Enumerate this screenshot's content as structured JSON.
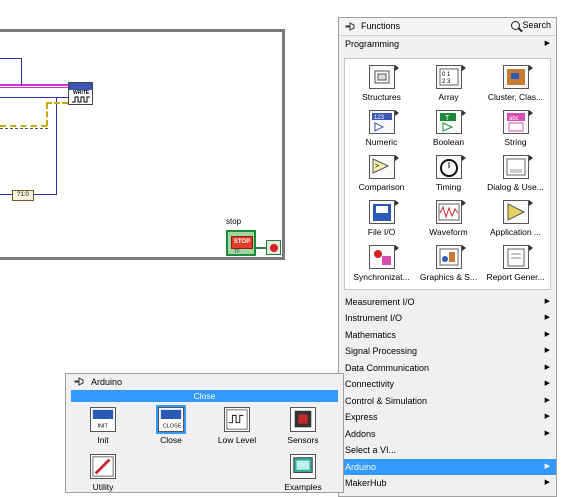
{
  "diagram": {
    "write_vi_label": "WRITE",
    "constant_label": "?1:0",
    "stop_label": "stop",
    "stop_button_text": "STOP",
    "stop_tf_text": "TF"
  },
  "functions_palette": {
    "title": "Functions",
    "search_label": "Search",
    "top_category": "Programming",
    "icons": [
      {
        "label": "Structures",
        "icon": "structures-icon"
      },
      {
        "label": "Array",
        "icon": "array-icon"
      },
      {
        "label": "Cluster, Clas...",
        "icon": "cluster-icon"
      },
      {
        "label": "Numeric",
        "icon": "numeric-icon"
      },
      {
        "label": "Boolean",
        "icon": "boolean-icon"
      },
      {
        "label": "String",
        "icon": "string-icon"
      },
      {
        "label": "Comparison",
        "icon": "comparison-icon"
      },
      {
        "label": "Timing",
        "icon": "timing-icon"
      },
      {
        "label": "Dialog & Use...",
        "icon": "dialog-icon"
      },
      {
        "label": "File I/O",
        "icon": "file-io-icon"
      },
      {
        "label": "Waveform",
        "icon": "waveform-icon"
      },
      {
        "label": "Application ...",
        "icon": "application-control-icon"
      },
      {
        "label": "Synchronizat...",
        "icon": "synchronization-icon"
      },
      {
        "label": "Graphics & S...",
        "icon": "graphics-sound-icon"
      },
      {
        "label": "Report Gener...",
        "icon": "report-generation-icon"
      }
    ],
    "categories": [
      "Measurement I/O",
      "Instrument I/O",
      "Mathematics",
      "Signal Processing",
      "Data Communication",
      "Connectivity",
      "Control & Simulation",
      "Express",
      "Addons",
      "Select a VI...",
      "Arduino",
      "MakerHub"
    ],
    "selected_category": "Arduino"
  },
  "arduino_palette": {
    "title": "Arduino",
    "close_label": "Close",
    "items": [
      {
        "label": "Init",
        "icon": "init-icon",
        "selected": false
      },
      {
        "label": "Close",
        "icon": "close-vi-icon",
        "selected": true
      },
      {
        "label": "Low Level",
        "icon": "low-level-icon",
        "selected": false
      },
      {
        "label": "Sensors",
        "icon": "sensors-icon",
        "selected": false
      },
      {
        "label": "Utility",
        "icon": "utility-icon",
        "selected": false
      },
      {
        "label": "Examples",
        "icon": "examples-icon",
        "selected": false
      }
    ]
  }
}
